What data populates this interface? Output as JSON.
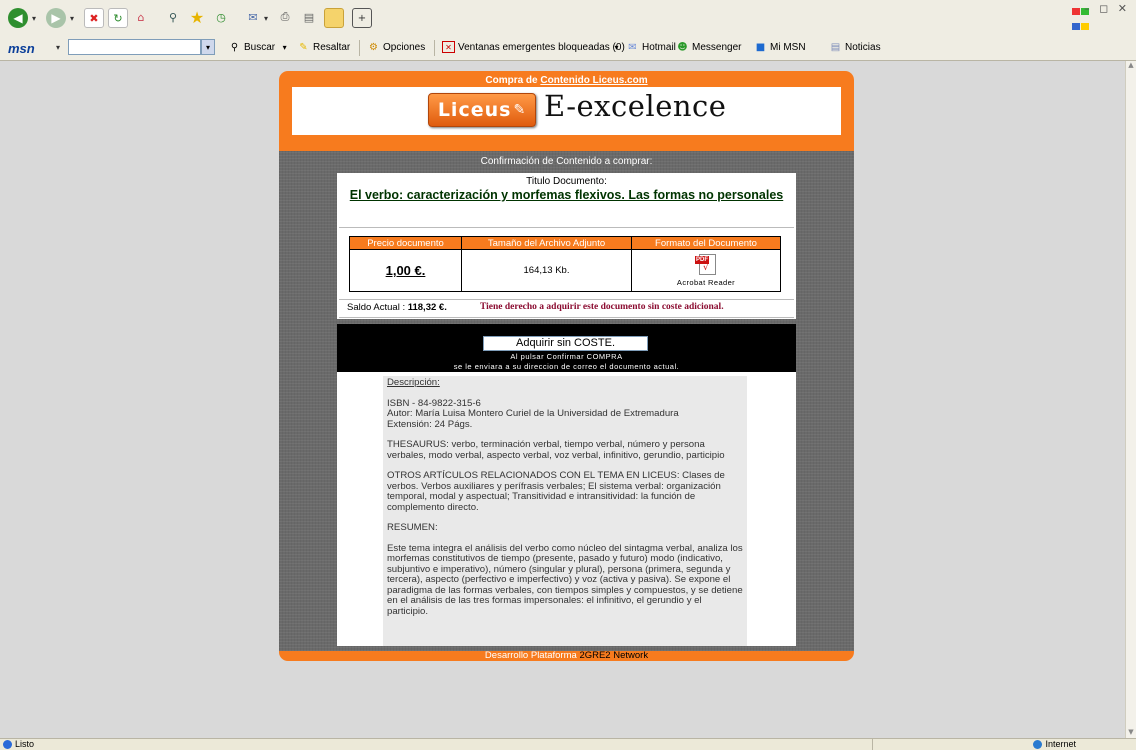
{
  "browser": {
    "nav_icons": [
      "back-icon",
      "forward-icon",
      "stop-icon",
      "refresh-icon",
      "home-icon",
      "search-icon",
      "favorites-icon",
      "history-icon",
      "mail-icon",
      "print-icon",
      "edit-icon",
      "folder-icon",
      "messenger-icon"
    ],
    "msn_logo": "msn",
    "search_value": "",
    "toolbar_buttons": {
      "buscar": "Buscar",
      "resaltar": "Resaltar",
      "opciones": "Opciones",
      "popups": "Ventanas emergentes bloqueadas (0)",
      "hotmail": "Hotmail",
      "messenger": "Messenger",
      "mimsn": "Mi MSN",
      "noticias": "Noticias"
    },
    "status_left": "Listo",
    "status_right": "Internet"
  },
  "page": {
    "header_prefix": "Compra de ",
    "header_link": "Contenido Liceus.com",
    "logo_liceus": "Liceus",
    "logo_eexcellence": "E-excelence",
    "confirm_text": "Confirmación de Contenido a comprar:",
    "doc_label": "Titulo Documento:",
    "doc_title": "El verbo: caracterización y morfemas flexivos. Las formas no personales",
    "table": {
      "headers": [
        "Precio documento",
        "Tamaño del Archivo Adjunto",
        "Formato del Documento"
      ],
      "price": "1,00 €.",
      "size": "164,13 Kb.",
      "format": "Acrobat Reader"
    },
    "saldo_label": "Saldo Actual : ",
    "saldo_value": "118,32 €.",
    "saldo_msg": "Tiene derecho a adquirir este documento sin coste adicional.",
    "buy_button": "Adquirir sin COSTE.",
    "band_line1": "Al pulsar Confirmar COMPRA",
    "band_line2": "se le enviara a su direccion de correo el documento actual.",
    "description": {
      "heading": "Descripción:",
      "p1": "ISBN - 84-9822-315-6\nAutor: María Luisa Montero Curiel de la Universidad de Extremadura\nExtensión: 24 Págs.",
      "p2": "THESAURUS: verbo, terminación verbal, tiempo verbal, número y persona verbales, modo verbal, aspecto verbal, voz verbal, infinitivo, gerundio, participio",
      "p3": "OTROS ARTÍCULOS RELACIONADOS CON EL TEMA EN LICEUS: Clases de verbos. Verbos auxiliares y perífrasis verbales; El sistema verbal: organización temporal, modal y aspectual; Transitividad e intransitividad: la función de complemento directo.",
      "p4": "RESUMEN:",
      "p5": "Este tema integra el análisis del verbo como núcleo del sintagma verbal, analiza los morfemas constitutivos de tiempo (presente, pasado y futuro) modo (indicativo, subjuntivo e imperativo), número (singular y plural), persona (primera, segunda y tercera), aspecto (perfectivo e imperfectivo) y voz (activa y pasiva). Se expone el paradigma de las formas verbales, con tiempos simples y compuestos, y se detiene en el análisis de las tres formas impersonales: el infinitivo, el gerundio y el participio."
    },
    "footer_prefix": "Desarrollo Plataforma ",
    "footer_network": "2GRE2 Network"
  },
  "colors": {
    "orange": "#f77b1e",
    "doc_title": "#003300",
    "saldo_msg": "#8b0c31"
  }
}
